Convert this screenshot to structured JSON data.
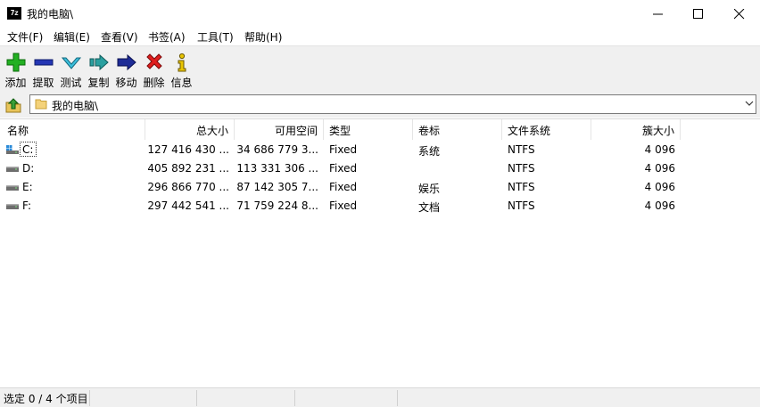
{
  "window": {
    "title": "我的电脑\\",
    "app_icon_text": "7z"
  },
  "menu": [
    "文件(F)",
    "编辑(E)",
    "查看(V)",
    "书签(A)",
    "工具(T)",
    "帮助(H)"
  ],
  "toolbar": [
    {
      "label": "添加",
      "icon": "add-icon",
      "color": "#1a9e1a"
    },
    {
      "label": "提取",
      "icon": "extract-icon",
      "color": "#1f2f9e"
    },
    {
      "label": "测试",
      "icon": "test-icon",
      "color": "#2aa5c0"
    },
    {
      "label": "复制",
      "icon": "copy-icon",
      "color": "#1c8a8a"
    },
    {
      "label": "移动",
      "icon": "move-icon",
      "color": "#1c2a8a"
    },
    {
      "label": "删除",
      "icon": "delete-icon",
      "color": "#d01a1a"
    },
    {
      "label": "信息",
      "icon": "info-icon",
      "color": "#d6b400"
    }
  ],
  "address": {
    "path": "我的电脑\\"
  },
  "columns": [
    "名称",
    "总大小",
    "可用空间",
    "类型",
    "卷标",
    "文件系统",
    "簇大小"
  ],
  "rows": [
    {
      "name": "C:",
      "total": "127 416 430 ...",
      "free": "34 686 779 3...",
      "type": "Fixed",
      "label": "系统",
      "fs": "NTFS",
      "cluster": "4 096"
    },
    {
      "name": "D:",
      "total": "405 892 231 ...",
      "free": "113 331 306 ...",
      "type": "Fixed",
      "label": "",
      "fs": "NTFS",
      "cluster": "4 096"
    },
    {
      "name": "E:",
      "total": "296 866 770 ...",
      "free": "87 142 305 7...",
      "type": "Fixed",
      "label": "娱乐",
      "fs": "NTFS",
      "cluster": "4 096"
    },
    {
      "name": "F:",
      "total": "297 442 541 ...",
      "free": "71 759 224 8...",
      "type": "Fixed",
      "label": "文档",
      "fs": "NTFS",
      "cluster": "4 096"
    }
  ],
  "status": {
    "text": "选定 0 / 4 个项目"
  }
}
